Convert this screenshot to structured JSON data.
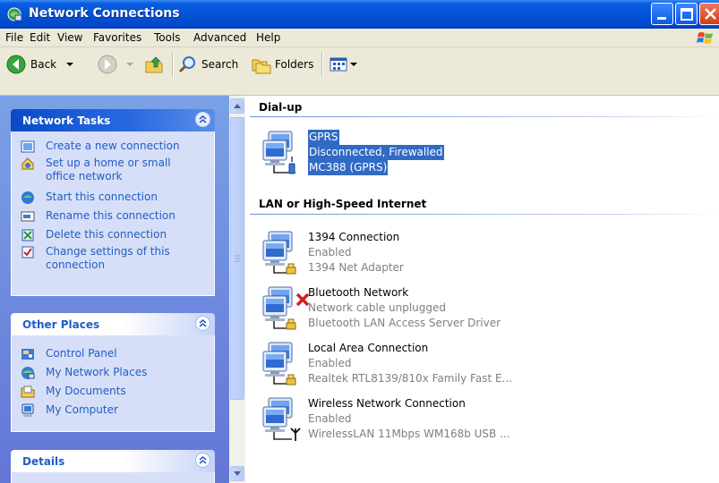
{
  "window": {
    "title": "Network Connections"
  },
  "menu": [
    "File",
    "Edit",
    "View",
    "Favorites",
    "Tools",
    "Advanced",
    "Help"
  ],
  "toolbar": {
    "back": "Back",
    "search": "Search",
    "folders": "Folders"
  },
  "network_tasks": {
    "title": "Network Tasks",
    "items": [
      "Create a new connection",
      "Set up a home or small office network",
      "Start this connection",
      "Rename this connection",
      "Delete this connection",
      "Change settings of this connection"
    ]
  },
  "other_places": {
    "title": "Other Places",
    "items": [
      "Control Panel",
      "My Network Places",
      "My Documents",
      "My Computer"
    ]
  },
  "details": {
    "title": "Details"
  },
  "groups": [
    {
      "title": "Dial-up",
      "connections": [
        {
          "name": "GPRS",
          "status": "Disconnected, Firewalled",
          "device": "MC388 (GPRS)",
          "selected": true
        }
      ]
    },
    {
      "title": "LAN or High-Speed Internet",
      "connections": [
        {
          "name": "1394 Connection",
          "status": "Enabled",
          "device": "1394 Net Adapter"
        },
        {
          "name": "Bluetooth Network",
          "status": "Network cable unplugged",
          "device": "Bluetooth LAN Access Server Driver"
        },
        {
          "name": "Local Area Connection",
          "status": "Enabled",
          "device": "Realtek RTL8139/810x Family Fast E..."
        },
        {
          "name": "Wireless Network Connection",
          "status": "Enabled",
          "device": "WirelessLAN 11Mbps WM168b USB ..."
        }
      ]
    }
  ],
  "colors": {
    "titlebar": "#0553d6",
    "selection": "#316ac5",
    "link": "#215dc6",
    "panel": "#7aa1e6"
  }
}
